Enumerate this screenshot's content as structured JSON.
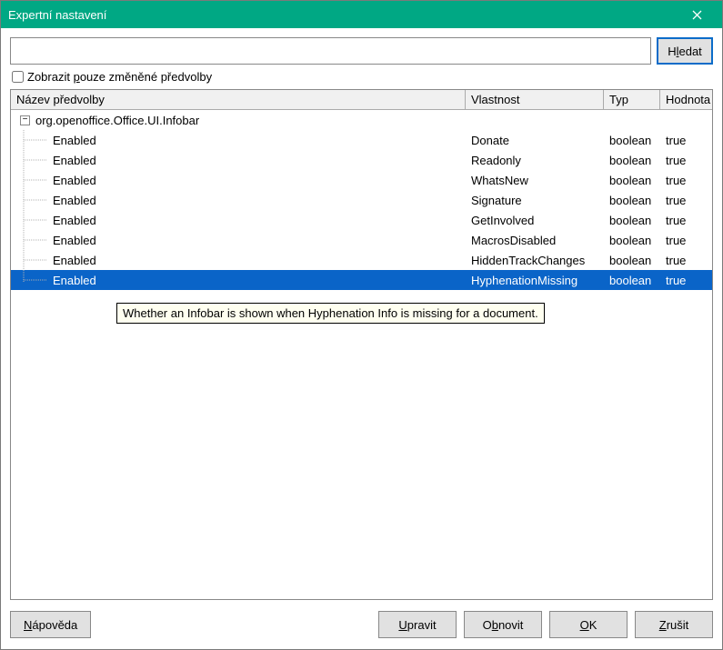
{
  "window": {
    "title": "Expertní nastavení"
  },
  "search": {
    "value": "",
    "placeholder": "",
    "button_label_pre": "H",
    "button_label_ul": "l",
    "button_label_post": "edat"
  },
  "checkbox": {
    "label_pre": "Zobrazit ",
    "label_ul": "p",
    "label_post": "ouze změněné předvolby",
    "checked": false
  },
  "columns": {
    "name": "Název předvolby",
    "prop": "Vlastnost",
    "type": "Typ",
    "value": "Hodnota"
  },
  "tree": {
    "group": "org.openoffice.Office.UI.Infobar",
    "rows": [
      {
        "name": "Enabled",
        "prop": "Donate",
        "type": "boolean",
        "value": "true",
        "selected": false
      },
      {
        "name": "Enabled",
        "prop": "Readonly",
        "type": "boolean",
        "value": "true",
        "selected": false
      },
      {
        "name": "Enabled",
        "prop": "WhatsNew",
        "type": "boolean",
        "value": "true",
        "selected": false
      },
      {
        "name": "Enabled",
        "prop": "Signature",
        "type": "boolean",
        "value": "true",
        "selected": false
      },
      {
        "name": "Enabled",
        "prop": "GetInvolved",
        "type": "boolean",
        "value": "true",
        "selected": false
      },
      {
        "name": "Enabled",
        "prop": "MacrosDisabled",
        "type": "boolean",
        "value": "true",
        "selected": false
      },
      {
        "name": "Enabled",
        "prop": "HiddenTrackChanges",
        "type": "boolean",
        "value": "true",
        "selected": false
      },
      {
        "name": "Enabled",
        "prop": "HyphenationMissing",
        "type": "boolean",
        "value": "true",
        "selected": true
      }
    ]
  },
  "tooltip": "Whether an Infobar is shown when Hyphenation Info is missing for a document.",
  "buttons": {
    "help_ul": "N",
    "help_post": "ápověda",
    "edit_ul": "U",
    "edit_post": "pravit",
    "reset_pre": "O",
    "reset_ul": "b",
    "reset_post": "novit",
    "ok_ul": "O",
    "ok_post": "K",
    "cancel_ul": "Z",
    "cancel_post": "rušit"
  }
}
